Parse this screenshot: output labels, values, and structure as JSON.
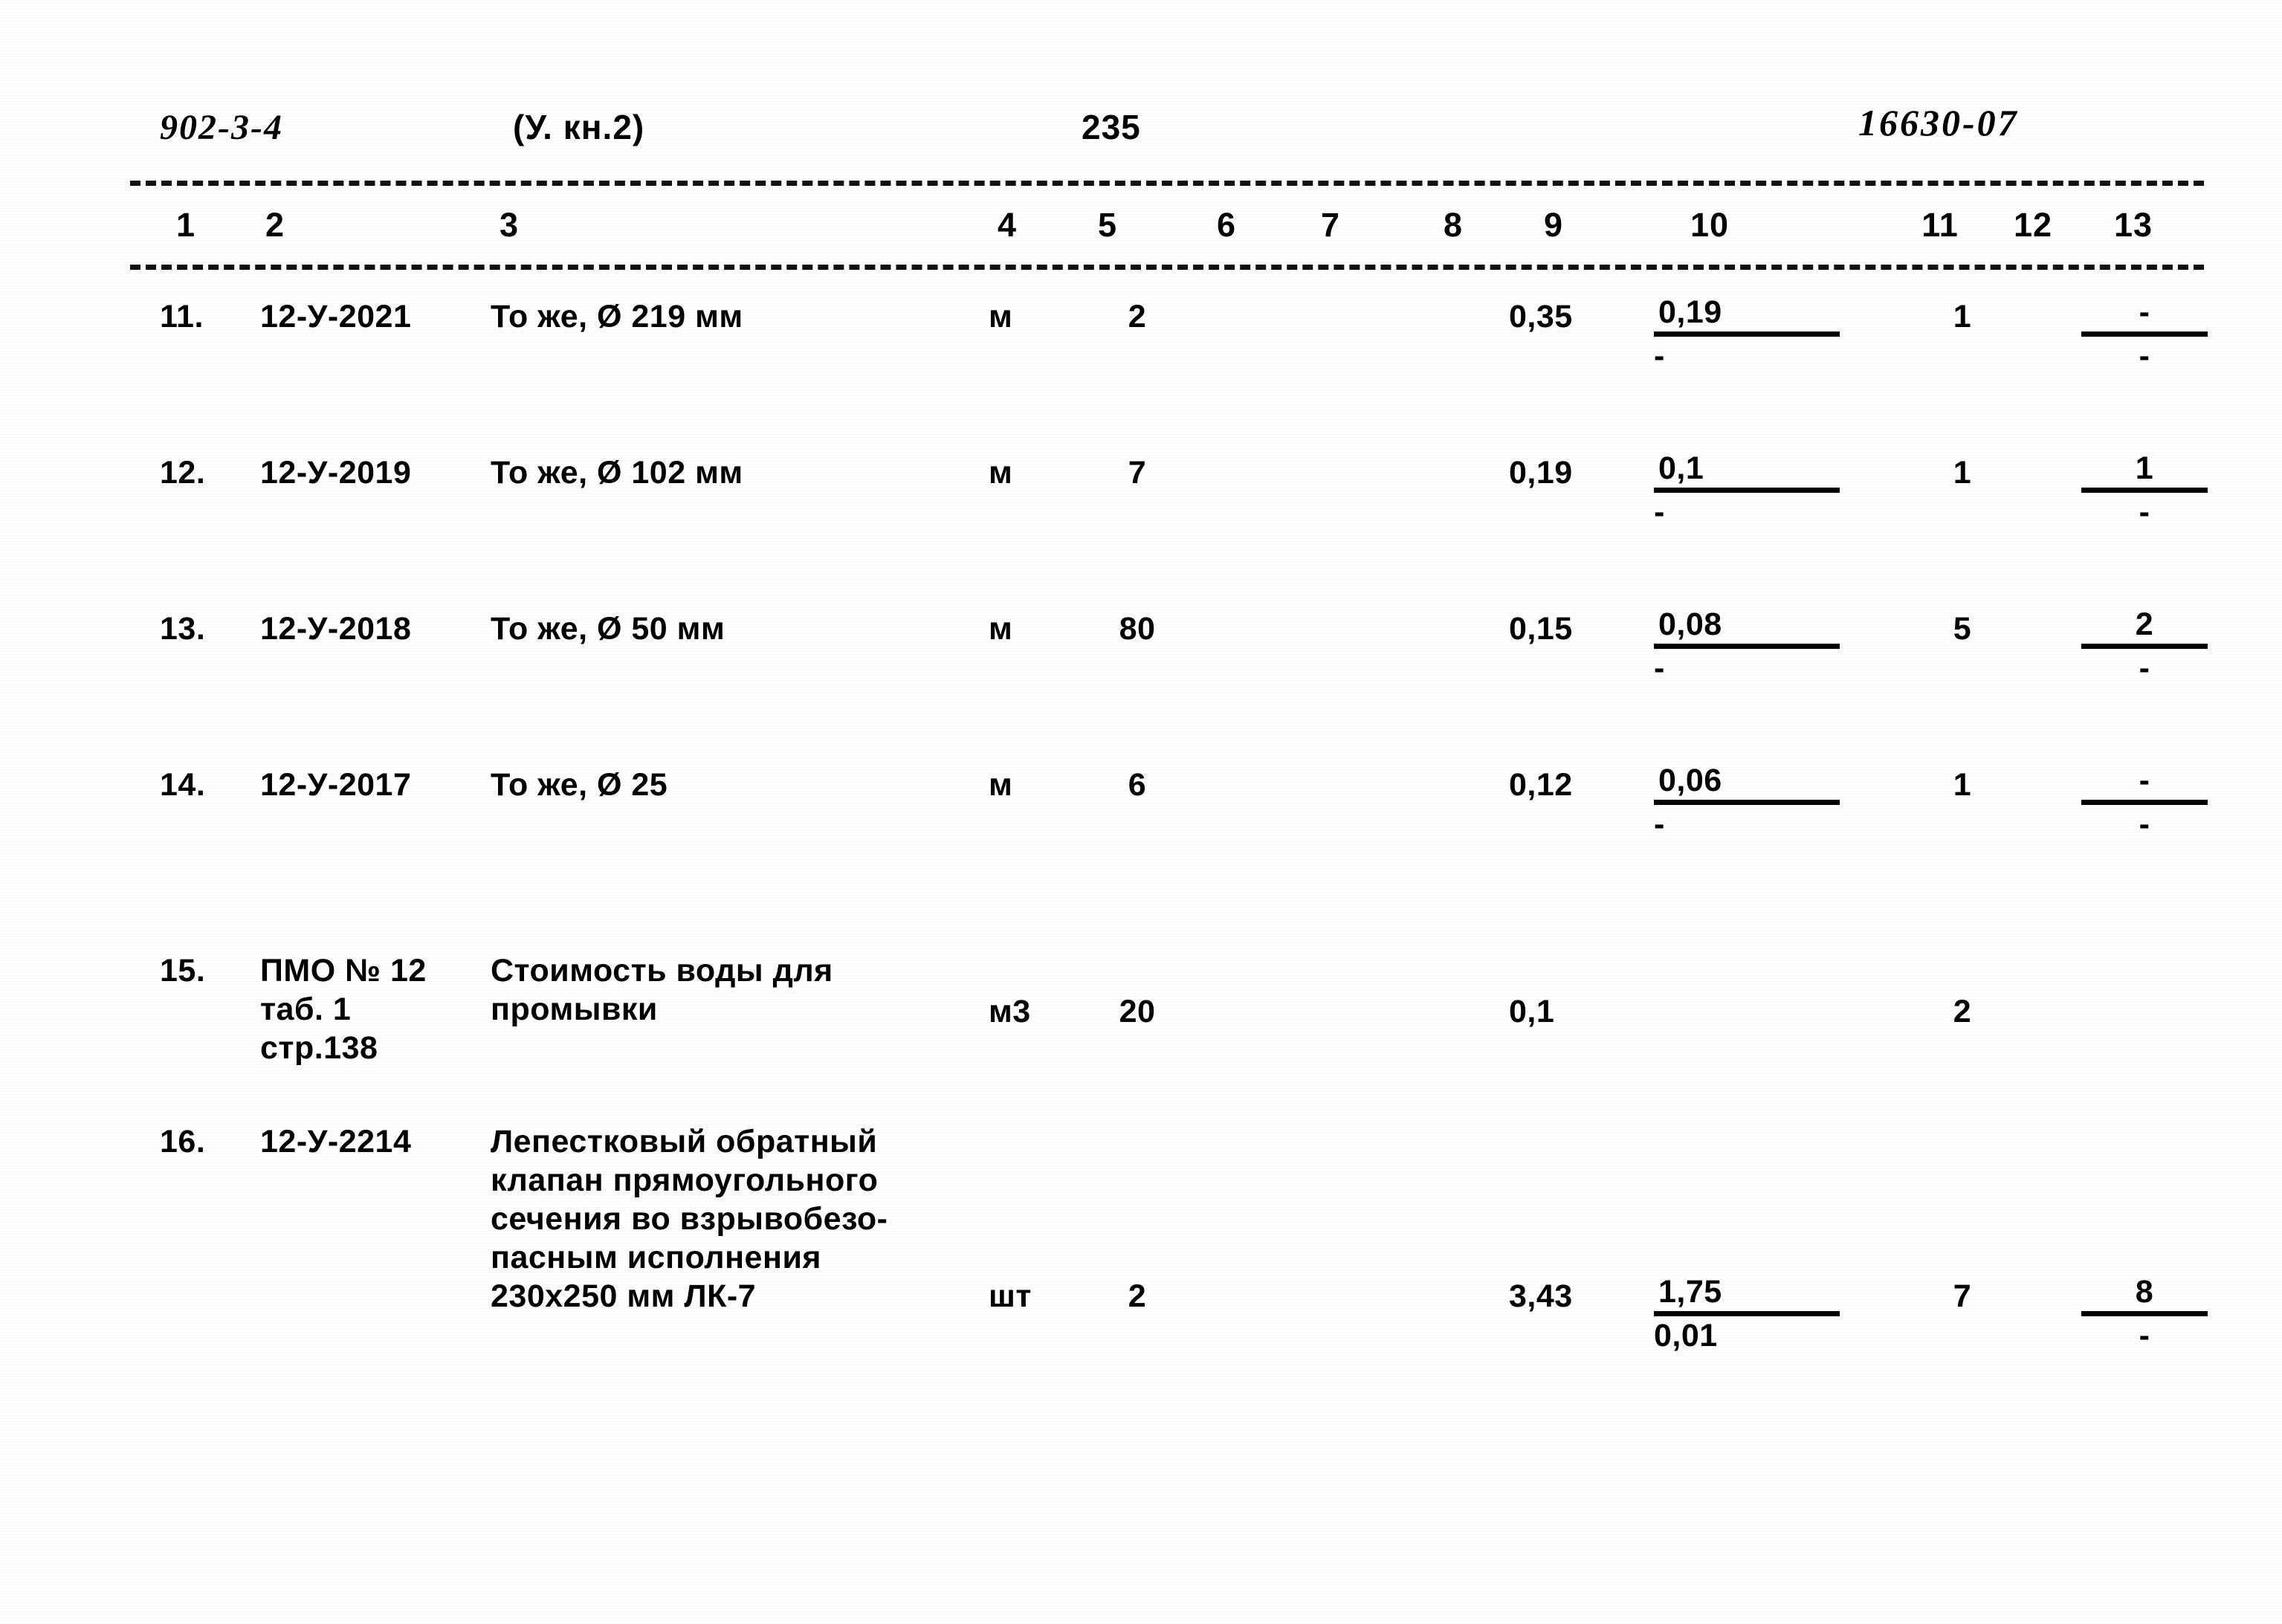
{
  "header": {
    "series_code": "902-3-4",
    "volume": "(У.  кн.2)",
    "page_number": "235",
    "document_number": "16630-07"
  },
  "column_numbers": [
    "1",
    "2",
    "3",
    "4",
    "5",
    "6",
    "7",
    "8",
    "9",
    "10",
    "11",
    "12",
    "13"
  ],
  "rows": [
    {
      "num": "11.",
      "code": "12-У-2021",
      "description": "То же, Ø 219 мм",
      "unit": "м",
      "qty": "2",
      "c6": "",
      "c7": "",
      "c8": "",
      "c9": "0,35",
      "c10_numer": "0,19",
      "c10_denom": "-",
      "c11": "1",
      "c13_numer": "-",
      "c13_denom": "-"
    },
    {
      "num": "12.",
      "code": "12-У-2019",
      "description": "То же, Ø 102 мм",
      "unit": "м",
      "qty": "7",
      "c6": "",
      "c7": "",
      "c8": "",
      "c9": "0,19",
      "c10_numer": "0,1",
      "c10_denom": "-",
      "c11": "1",
      "c13_numer": "1",
      "c13_denom": "-"
    },
    {
      "num": "13.",
      "code": "12-У-2018",
      "description": "То же, Ø 50 мм",
      "unit": "м",
      "qty": "80",
      "c6": "",
      "c7": "",
      "c8": "",
      "c9": "0,15",
      "c10_numer": "0,08",
      "c10_denom": "-",
      "c11": "5",
      "c13_numer": "2",
      "c13_denom": "-"
    },
    {
      "num": "14.",
      "code": "12-У-2017",
      "description": "То же, Ø 25",
      "unit": "м",
      "qty": "6",
      "c6": "",
      "c7": "",
      "c8": "",
      "c9": "0,12",
      "c10_numer": "0,06",
      "c10_denom": "-",
      "c11": "1",
      "c13_numer": "-",
      "c13_denom": "-"
    },
    {
      "num": "15.",
      "code": "ПМО № 12\nтаб. 1\nстр.138",
      "description": "Стоимость воды для\nпромывки",
      "unit": "м3",
      "qty": "20",
      "c6": "",
      "c7": "",
      "c8": "",
      "c9": "0,1",
      "c10_numer": "",
      "c10_denom": "",
      "c11": "2",
      "c13_numer": "",
      "c13_denom": ""
    },
    {
      "num": "16.",
      "code": "12-У-2214",
      "description": "Лепестковый обратный\nклапан прямоугольного\nсечения во взрывобезо-\nпасным исполнения\n230х250 мм ЛК-7",
      "unit": "шт",
      "qty": "2",
      "c6": "",
      "c7": "",
      "c8": "",
      "c9": "3,43",
      "c10_numer": "1,75",
      "c10_denom": "0,01",
      "c11": "7",
      "c13_numer": "8",
      "c13_denom": "-"
    }
  ]
}
